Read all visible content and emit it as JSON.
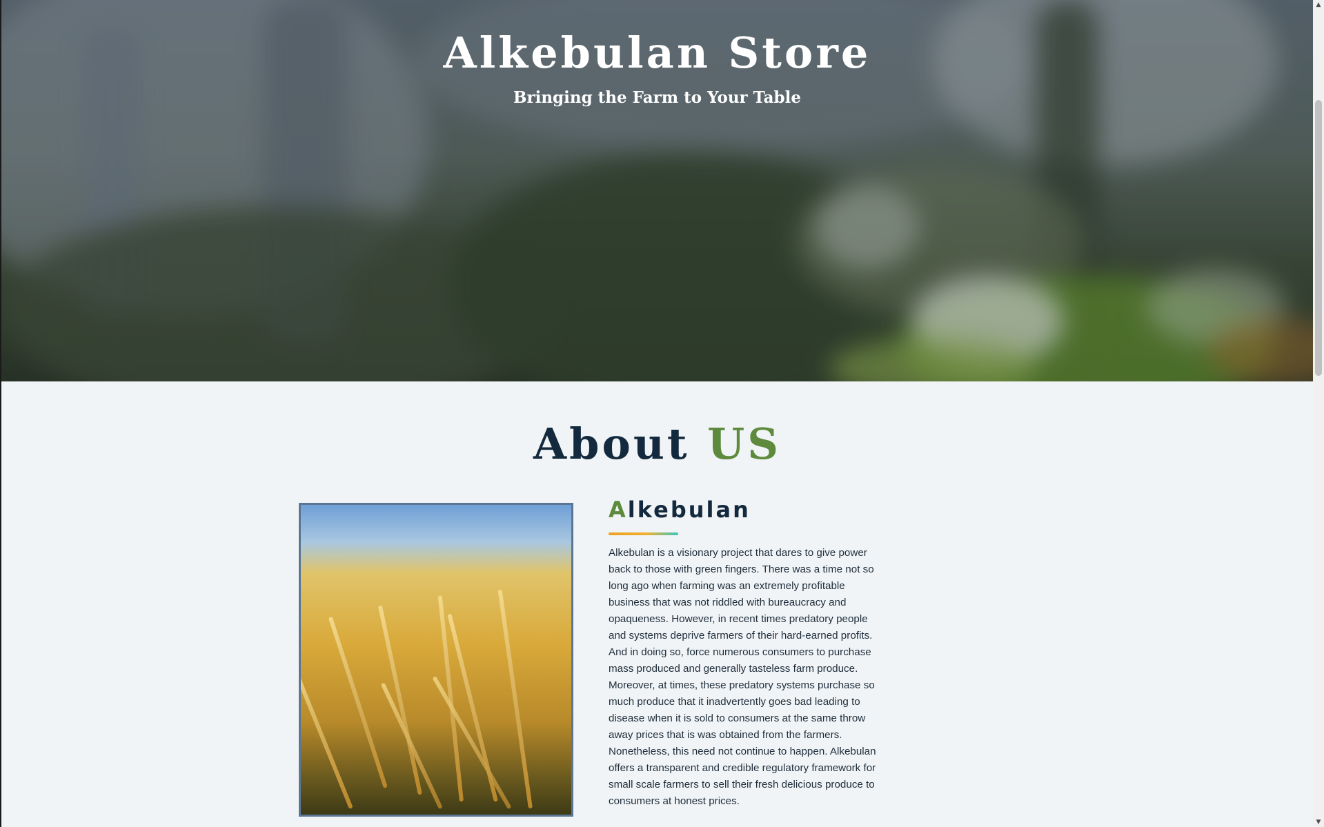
{
  "hero": {
    "title": "Alkebulan Store",
    "subtitle": "Bringing the Farm to Your Table"
  },
  "about": {
    "heading_main": "About",
    "heading_accent": "US",
    "brand_first_letter": "A",
    "brand_rest": "lkebulan",
    "paragraph": "Alkebulan is a visionary project that dares to give power back to those with green fingers. There was a time not so long ago when farming was an extremely profitable business that was not riddled with bureaucracy and opaqueness. However, in recent times predatory people and systems deprive farmers of their hard-earned profits. And in doing so, force numerous consumers to purchase mass produced and generally tasteless farm produce. Moreover, at times, these predatory systems purchase so much produce that it inadvertently goes bad leading to disease when it is sold to consumers at the same throw away prices that is was obtained from the farmers. Nonetheless, this need not continue to happen. Alkebulan offers a transparent and credible regulatory framework for small scale farmers to sell their fresh delicious produce to consumers at honest prices."
  },
  "scrollbar": {
    "up_icon": "chevron-up-icon",
    "down_icon": "chevron-down-icon"
  },
  "colors": {
    "dark_navy": "#13293d",
    "accent_green": "#5d8a3c",
    "background": "#f1f4f6",
    "photo_border": "#5b7694"
  }
}
